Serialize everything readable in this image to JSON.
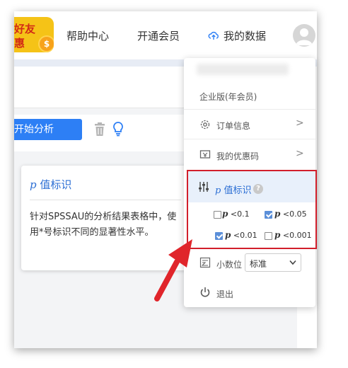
{
  "topbar": {
    "promo_line1": "好友",
    "promo_line2": "惠",
    "promo_coin": "$",
    "nav_help": "帮助中心",
    "nav_vip": "开通会员",
    "nav_data": "我的数据"
  },
  "toolbar": {
    "start_label": "开始分析"
  },
  "card": {
    "title_p": "p",
    "title_rest": " 值标识",
    "body": "针对SPSSAU的分析结果表格中，使用*号标识不同的显著性水平。"
  },
  "menu": {
    "edition": "企业版(年会员)",
    "orders": "订单信息",
    "coupons": "我的优惠码",
    "pvalue_p": "p",
    "pvalue_rest": " 值标识",
    "decimals": "小数位",
    "decimals_value": "标准",
    "logout": "退出",
    "chevron": ">",
    "help": "?"
  },
  "pvalue_options": [
    {
      "p": "p",
      "label": " <0.1",
      "checked": false
    },
    {
      "p": "p",
      "label": " <0.05",
      "checked": true
    },
    {
      "p": "p",
      "label": " <0.01",
      "checked": true
    },
    {
      "p": "p",
      "label": " <0.001",
      "checked": false
    }
  ],
  "colors": {
    "accent": "#2d7ff5",
    "highlight_border": "#d21f2b",
    "promo_bg": "#f5c317"
  }
}
